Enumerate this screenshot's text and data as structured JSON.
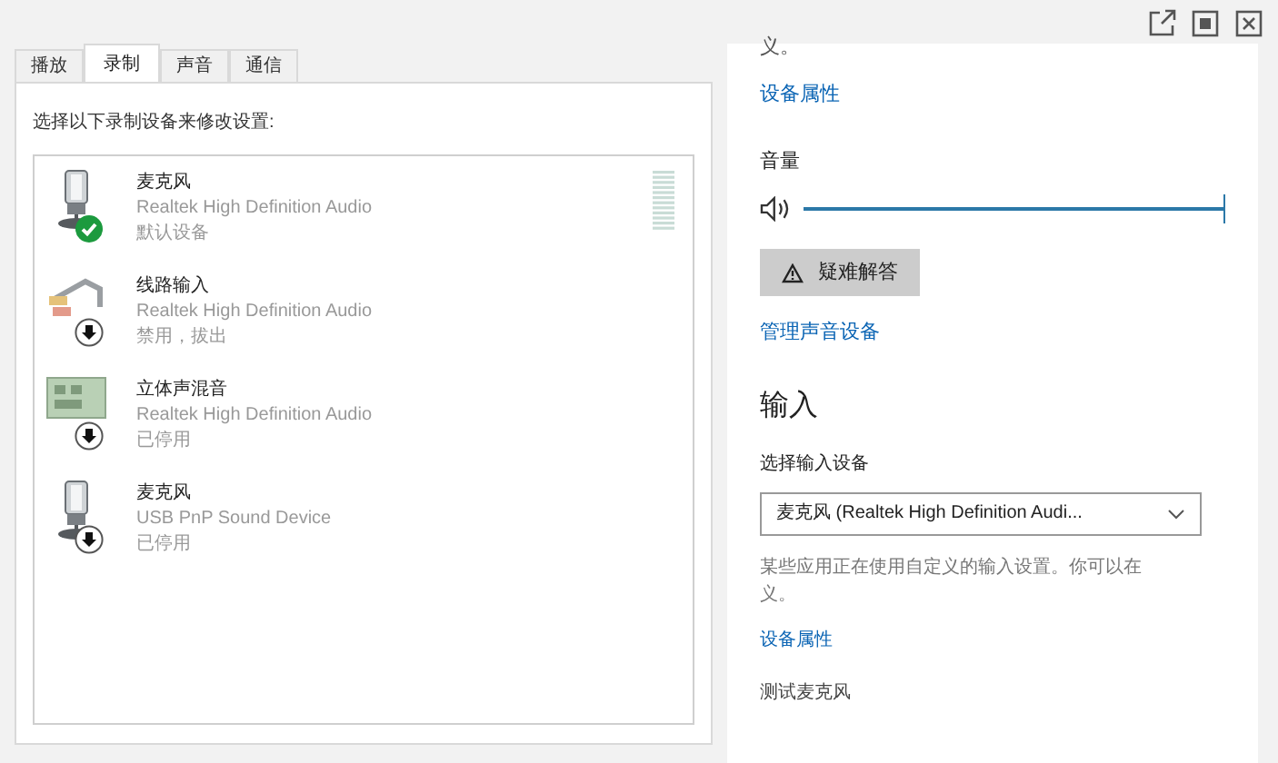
{
  "tabs": [
    {
      "label": "播放",
      "selected": false
    },
    {
      "label": "录制",
      "selected": true
    },
    {
      "label": "声音",
      "selected": false
    },
    {
      "label": "通信",
      "selected": false
    }
  ],
  "instruction": "选择以下录制设备来修改设置:",
  "devices": [
    {
      "name": "麦克风",
      "driver": "Realtek High Definition Audio",
      "status": "默认设备",
      "kind": "mic",
      "default": true,
      "selected": false
    },
    {
      "name": "线路输入",
      "driver": "Realtek High Definition Audio",
      "status": "禁用，拔出",
      "kind": "line",
      "default": false,
      "selected": false
    },
    {
      "name": "立体声混音",
      "driver": "Realtek High Definition Audio",
      "status": "已停用",
      "kind": "mix",
      "default": false,
      "selected": false
    },
    {
      "name": "麦克风",
      "driver": "USB PnP Sound Device",
      "status": "已停用",
      "kind": "mic",
      "default": false,
      "selected": false
    }
  ],
  "settings": {
    "cut_top_text": "义。",
    "output_properties_link": "设备属性",
    "volume_label": "音量",
    "volume": {
      "level": 1
    },
    "troubleshoot_button": "疑难解答",
    "manage_link": "管理声音设备",
    "input_heading": "输入",
    "input_select_label": "选择输入设备",
    "input_device": "麦克风 (Realtek High Definition Audi...",
    "note_lines": [
      "某些应用正在使用自定义的输入设置。你可以在",
      "义。"
    ],
    "input_properties_link": "设备属性",
    "test_label": "测试麦克风"
  }
}
